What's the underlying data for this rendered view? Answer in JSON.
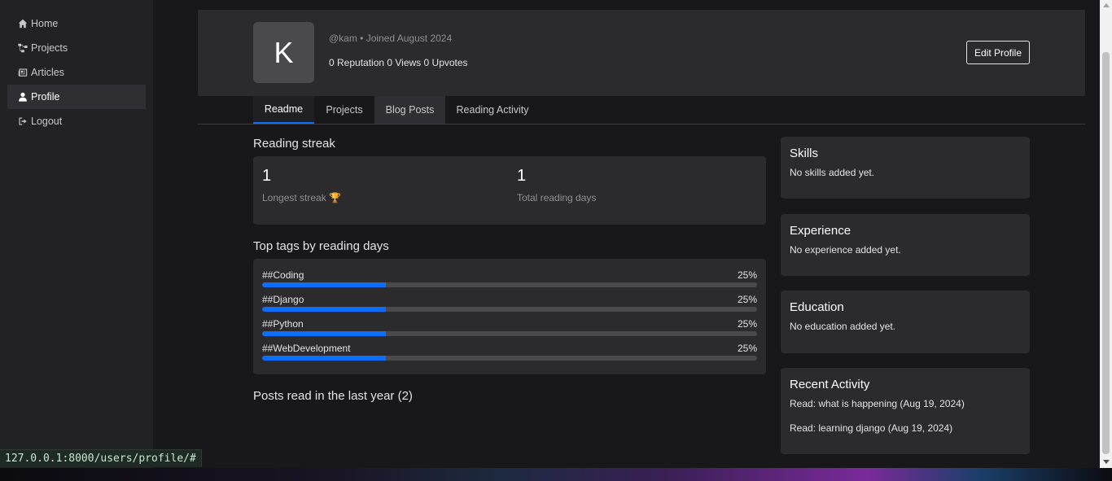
{
  "sidebar": {
    "items": [
      {
        "label": "Home",
        "icon": "home-icon",
        "active": false
      },
      {
        "label": "Projects",
        "icon": "project-diagram-icon",
        "active": false
      },
      {
        "label": "Articles",
        "icon": "newspaper-icon",
        "active": false
      },
      {
        "label": "Profile",
        "icon": "user-icon",
        "active": true
      },
      {
        "label": "Logout",
        "icon": "logout-icon",
        "active": false
      }
    ]
  },
  "profile": {
    "avatar_letter": "K",
    "meta": "@kam • Joined August 2024",
    "stats": "0 Reputation 0 Views 0 Upvotes",
    "edit_label": "Edit Profile"
  },
  "tabs": [
    {
      "label": "Readme",
      "active": true
    },
    {
      "label": "Projects",
      "active": false
    },
    {
      "label": "Blog Posts",
      "active": false
    },
    {
      "label": "Reading Activity",
      "active": false
    }
  ],
  "reading_streak": {
    "title": "Reading streak",
    "longest_value": "1",
    "longest_label": "Longest streak 🏆",
    "total_value": "1",
    "total_label": "Total reading days"
  },
  "top_tags": {
    "title": "Top tags by reading days",
    "items": [
      {
        "name": "##Coding",
        "percent_label": "25%",
        "fraction": 0.25
      },
      {
        "name": "##Django",
        "percent_label": "25%",
        "fraction": 0.25
      },
      {
        "name": "##Python",
        "percent_label": "25%",
        "fraction": 0.25
      },
      {
        "name": "##WebDevelopment",
        "percent_label": "25%",
        "fraction": 0.25
      }
    ]
  },
  "posts_read_title": "Posts read in the last year (2)",
  "side_cards": {
    "skills": {
      "title": "Skills",
      "text": "No skills added yet."
    },
    "experience": {
      "title": "Experience",
      "text": "No experience added yet."
    },
    "education": {
      "title": "Education",
      "text": "No education added yet."
    },
    "recent_activity": {
      "title": "Recent Activity",
      "items": [
        "Read: what is happening (Aug 19, 2024)",
        "Read: learning django (Aug 19, 2024)"
      ]
    }
  },
  "status_bar_url": "127.0.0.1:8000/users/profile/#",
  "colors": {
    "accent": "#0d6efd",
    "background": "#18181b",
    "card": "#2b2b2e"
  }
}
